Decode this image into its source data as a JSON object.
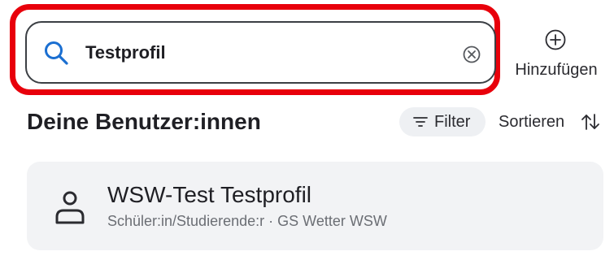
{
  "search": {
    "value": "Testprofil",
    "icon": "search-icon",
    "clear_icon": "clear-icon",
    "accent_color": "#1b6fd1"
  },
  "highlight_color": "#e8000b",
  "add": {
    "label": "Hinzufügen",
    "icon": "plus-circle-icon"
  },
  "section": {
    "title": "Deine Benutzer:innen",
    "filter_label": "Filter",
    "filter_icon": "filter-icon",
    "sort_label": "Sortieren",
    "sort_icon": "sort-icon"
  },
  "users": [
    {
      "name": "WSW-Test Testprofil",
      "role": "Schüler:in/Studierende:r",
      "separator": "·",
      "school": "GS Wetter WSW",
      "icon": "person-icon"
    }
  ]
}
